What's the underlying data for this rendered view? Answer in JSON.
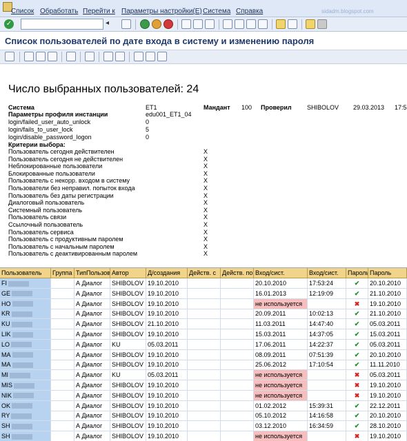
{
  "menu": {
    "items": [
      "Список",
      "Обработать",
      "Перейти к",
      "Параметры настройки(Е)",
      "Система",
      "Справка"
    ],
    "watermark": "sidadm.blogspot.com"
  },
  "toolbar": {
    "command_value": ""
  },
  "title": "Список пользователей по дате входа в систему и изменению пароля",
  "report": {
    "heading": "Число выбранных пользователей: 24",
    "system_label": "Система",
    "system_value": "ET1",
    "client_label": "Мандант",
    "client_value": "100",
    "checked_label": "Проверил",
    "checked_value": "SHIBOLOV",
    "date_value": "29.03.2013",
    "time_value": "17:5",
    "profile_label": "Параметры профиля инстанции",
    "profile_value": "edu001_ET1_04",
    "params": [
      {
        "name": "login/failed_user_auto_unlock",
        "value": "0"
      },
      {
        "name": "login/fails_to_user_lock",
        "value": "5"
      },
      {
        "name": "login/disable_password_logon",
        "value": "0"
      }
    ],
    "criteria_label": "Критерии выбора:",
    "criteria": [
      {
        "name": "Пользователь сегодня действителен",
        "value": "X"
      },
      {
        "name": "Пользователь сегодня не действителен",
        "value": "X"
      },
      {
        "name": "Неблокированные пользователи",
        "value": "X"
      },
      {
        "name": "Блокированные пользователи",
        "value": "X"
      },
      {
        "name": "Пользователь с некорр. входом в систему",
        "value": "X"
      },
      {
        "name": "Пользователи без неправил. попыток входа",
        "value": "X"
      },
      {
        "name": "Пользователь без даты регистрации",
        "value": "X"
      },
      {
        "name": "Диалоговый пользователь",
        "value": "X"
      },
      {
        "name": "Системный пользователь",
        "value": "X"
      },
      {
        "name": "Пользователь связи",
        "value": "X"
      },
      {
        "name": "Ссылочный пользователь",
        "value": "X"
      },
      {
        "name": "Пользователь сервиса",
        "value": "X"
      },
      {
        "name": "Пользователь с продуктивным паролем",
        "value": "X"
      },
      {
        "name": "Пользователь с начальным паролем",
        "value": "X"
      },
      {
        "name": "Пользователь с деактивированным паролем",
        "value": "X"
      }
    ]
  },
  "grid": {
    "headers": [
      "Пользователь",
      "Группа",
      "ТипПользов",
      "Автор",
      "Д/создания",
      "Действ. с",
      "Действ. по",
      "Вход/сист.",
      "Вход/сист.",
      "Пароль",
      "Пароль"
    ],
    "rows": [
      {
        "user": "FI",
        "type": "А Диалог",
        "author": "SHIBOLOV",
        "created": "19.10.2010",
        "login_date": "20.10.2010",
        "login_time": "17:53:24",
        "pw_ok": true,
        "pw_date": "20.10.2010"
      },
      {
        "user": "GE",
        "type": "А Диалог",
        "author": "SHIBOLOV",
        "created": "19.10.2010",
        "login_date": "16.01.2013",
        "login_time": "12:19:09",
        "pw_ok": true,
        "pw_date": "21.10.2010"
      },
      {
        "user": "HO",
        "type": "А Диалог",
        "author": "SHIBOLOV",
        "created": "19.10.2010",
        "login_date": "не используется",
        "login_time": "",
        "pw_ok": false,
        "pw_date": "19.10.2010"
      },
      {
        "user": "KR",
        "type": "А Диалог",
        "author": "SHIBOLOV",
        "created": "19.10.2010",
        "login_date": "20.09.2011",
        "login_time": "10:02:13",
        "pw_ok": true,
        "pw_date": "21.10.2010"
      },
      {
        "user": "KU",
        "type": "А Диалог",
        "author": "SHIBOLOV",
        "created": "21.10.2010",
        "login_date": "11.03.2011",
        "login_time": "14:47:40",
        "pw_ok": true,
        "pw_date": "05.03.2011"
      },
      {
        "user": "LIK",
        "type": "А Диалог",
        "author": "SHIBOLOV",
        "created": "19.10.2010",
        "login_date": "15.03.2011",
        "login_time": "14:37:05",
        "pw_ok": true,
        "pw_date": "15.03.2011"
      },
      {
        "user": "LO",
        "type": "А Диалог",
        "author": "KU",
        "created": "05.03.2011",
        "login_date": "17.06.2011",
        "login_time": "14:22:37",
        "pw_ok": true,
        "pw_date": "05.03.2011"
      },
      {
        "user": "MA",
        "type": "А Диалог",
        "author": "SHIBOLOV",
        "created": "19.10.2010",
        "login_date": "08.09.2011",
        "login_time": "07:51:39",
        "pw_ok": true,
        "pw_date": "20.10.2010"
      },
      {
        "user": "MA",
        "type": "А Диалог",
        "author": "SHIBOLOV",
        "created": "19.10.2010",
        "login_date": "25.06.2012",
        "login_time": "17:10:54",
        "pw_ok": true,
        "pw_date": "11.11.2010"
      },
      {
        "user": "MI",
        "type": "А Диалог",
        "author": "KU",
        "created": "05.03.2011",
        "login_date": "не используется",
        "login_time": "",
        "pw_ok": false,
        "pw_date": "05.03.2011"
      },
      {
        "user": "MIS",
        "type": "А Диалог",
        "author": "SHIBOLOV",
        "created": "19.10.2010",
        "login_date": "не используется",
        "login_time": "",
        "pw_ok": false,
        "pw_date": "19.10.2010"
      },
      {
        "user": "NIK",
        "type": "А Диалог",
        "author": "SHIBOLOV",
        "created": "19.10.2010",
        "login_date": "не используется",
        "login_time": "",
        "pw_ok": false,
        "pw_date": "19.10.2010"
      },
      {
        "user": "OK",
        "type": "А Диалог",
        "author": "SHIBOLOV",
        "created": "19.10.2010",
        "login_date": "01.02.2012",
        "login_time": "15:39:31",
        "pw_ok": true,
        "pw_date": "22.12.2011"
      },
      {
        "user": "RY",
        "type": "А Диалог",
        "author": "SHIBOLOV",
        "created": "19.10.2010",
        "login_date": "05.10.2012",
        "login_time": "14:16:58",
        "pw_ok": true,
        "pw_date": "20.10.2010"
      },
      {
        "user": "SH",
        "type": "А Диалог",
        "author": "SHIBOLOV",
        "created": "19.10.2010",
        "login_date": "03.12.2010",
        "login_time": "16:34:59",
        "pw_ok": true,
        "pw_date": "28.10.2010"
      },
      {
        "user": "SH",
        "type": "А Диалог",
        "author": "SHIBOLOV",
        "created": "19.10.2010",
        "login_date": "не используется",
        "login_time": "",
        "pw_ok": false,
        "pw_date": "19.10.2010"
      }
    ]
  }
}
